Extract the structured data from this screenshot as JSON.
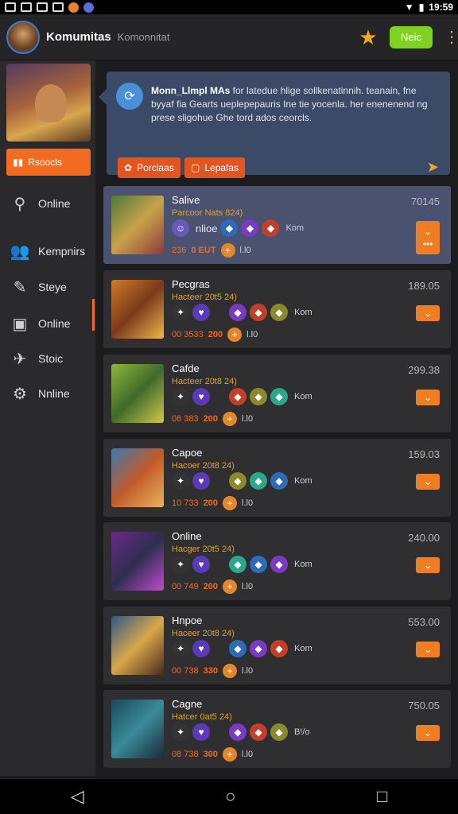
{
  "status": {
    "time": "19:59"
  },
  "header": {
    "title": "Komumitas",
    "subtitle": "Komonnitat",
    "new_label": "Neic"
  },
  "sidebar": {
    "recommend_label": "Rsoocls",
    "items": [
      {
        "label": "Online",
        "icon": "search-icon"
      },
      {
        "label": "Kempnirs",
        "icon": "people-icon"
      },
      {
        "label": "Steye",
        "icon": "pencil-icon"
      },
      {
        "label": "Online",
        "icon": "window-icon"
      },
      {
        "label": "Stoic",
        "icon": "plane-icon"
      },
      {
        "label": "Nnline",
        "icon": "gear-icon"
      }
    ]
  },
  "banner": {
    "bold": "Monn_Llmpl MAs",
    "text": "for latedue hlige sollkenatinnih. teanain, fne byyaf fia Gearts ueplepepauris Ine tie yocenla. her enenenend ng prese sligohue Ghe tord ados ceorcls.",
    "btn1": "Porclaas",
    "btn2": "Lepafas"
  },
  "cards": [
    {
      "title": "Salive",
      "sub": "Parcoor Nats 824)",
      "value": "70145",
      "mid": "nlioe",
      "s1": "236",
      "s2": "0 EUT",
      "s3": "l.l0",
      "tag": "Kom"
    },
    {
      "title": "Pecgras",
      "sub": "Hacteer 20t5 24)",
      "value": "189.05",
      "s1": "00 3533",
      "s2": "200",
      "s3": "l.l0",
      "tag": "Kom"
    },
    {
      "title": "Cafde",
      "sub": "Hacteer 20t8 24)",
      "value": "299.38",
      "s1": "06 383",
      "s2": "200",
      "s3": "l.l0",
      "tag": "Kom"
    },
    {
      "title": "Capoe",
      "sub": "Hacoer 20t8 24)",
      "value": "159.03",
      "s1": "10 733",
      "s2": "200",
      "s3": "l.l0",
      "tag": "Kom"
    },
    {
      "title": "Online",
      "sub": "Hacger 20t5 24)",
      "value": "240.00",
      "s1": "00 749",
      "s2": "200",
      "s3": "l.l0",
      "tag": "Kom"
    },
    {
      "title": "Hnpoe",
      "sub": "Haceer 20t8 24)",
      "value": "553.00",
      "s1": "00 738",
      "s2": "330",
      "s3": "l.l0",
      "tag": "Kom"
    },
    {
      "title": "Cagne",
      "sub": "Hatcer 0at5 24)",
      "value": "750.05",
      "s1": "08 738",
      "s2": "300",
      "s3": "l.l0",
      "tag": "B!/o"
    }
  ],
  "colors": {
    "accent": "#f26b21",
    "new": "#7ed321",
    "banner": "#3b4a66"
  }
}
